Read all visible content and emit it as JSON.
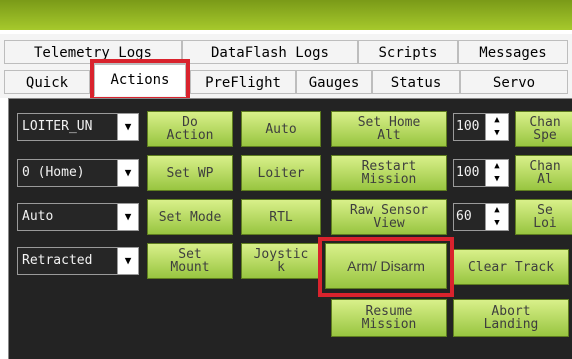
{
  "tabs_row1": [
    "Telemetry Logs",
    "DataFlash Logs",
    "Scripts",
    "Messages"
  ],
  "tabs_row2": [
    "Quick",
    "Actions",
    "PreFlight",
    "Gauges",
    "Status",
    "Servo"
  ],
  "combos": [
    "LOITER_UN",
    "0 (Home)",
    "Auto",
    "Retracted"
  ],
  "buttons": {
    "do_action": "Do\nAction",
    "set_wp": "Set WP",
    "set_mode": "Set Mode",
    "set_mount": "Set\nMount",
    "auto": "Auto",
    "loiter": "Loiter",
    "rtl": "RTL",
    "joystick": "Joystic\nk",
    "set_home_alt": "Set Home\nAlt",
    "restart_mission": "Restart\nMission",
    "raw_sensor_view": "Raw Sensor\nView",
    "arm_disarm": "Arm/ Disarm",
    "resume_mission": "Resume\nMission",
    "clear_track": "Clear Track",
    "abort_landing": "Abort\nLanding",
    "change_speed": "Chan\nSpe",
    "change_alt": "Chan\nAl",
    "set_loiter": "Se\nLoi"
  },
  "numbers": [
    "100",
    "100",
    "60"
  ],
  "highlight_color": "#d9232d"
}
